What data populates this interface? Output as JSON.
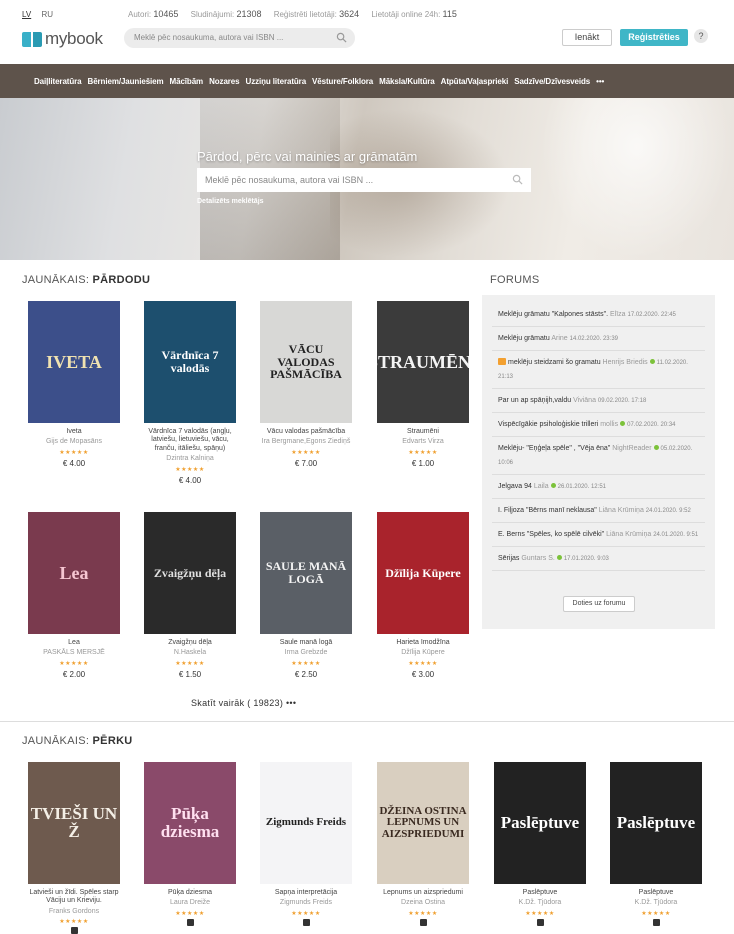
{
  "header": {
    "lang": [
      "LV",
      "RU"
    ],
    "stats": [
      {
        "label": "Autori:",
        "value": "10465"
      },
      {
        "label": "Sludinājumi:",
        "value": "21308"
      },
      {
        "label": "Reģistrēti lietotāji:",
        "value": "3624"
      },
      {
        "label": "Lietotāji online 24h:",
        "value": "115"
      }
    ],
    "logo": "mybook",
    "search_placeholder": "Meklē pēc nosaukuma, autora vai ISBN ...",
    "login": "Ienākt",
    "register": "Reģistrēties",
    "help": "?"
  },
  "nav": [
    "Daiļliteratūra",
    "Bērniem/Jauniešiem",
    "Mācībām",
    "Nozares",
    "Uzziņu literatūra",
    "Vēsture/Folklora",
    "Māksla/Kultūra",
    "Atpūta/Vaļasprieki",
    "Sadzīve/Dzīvesveids",
    "•••"
  ],
  "hero": {
    "title": "Pārdod, pērc vai mainies ar grāmatām",
    "search_placeholder": "Meklē pēc nosaukuma, autora vai ISBN ...",
    "advanced": "Detalizēts meklētājs"
  },
  "selling": {
    "title_prefix": "JAUNĀKAIS:",
    "title_bold": "PĀRDODU",
    "books": [
      {
        "title": "Iveta",
        "author": "Gijs de Mopasāns",
        "price": "€ 4.00",
        "cover_text": "IVETA",
        "bg": "#3c4f8a",
        "fg": "#f0e2b0"
      },
      {
        "title": "Vārdnīca 7 valodās (angļu, latviešu, lietuviešu, vācu, franču, itāliešu, spāņu)",
        "author": "Dzintra Kalniņa",
        "price": "€ 4.00",
        "cover_text": "Vārdnīca 7 valodās",
        "bg": "#1d4f6e",
        "fg": "#ffffff"
      },
      {
        "title": "Vācu valodas pašmācība",
        "author": "Ira Bergmane,Egons Ziediņš",
        "price": "€ 7.00",
        "cover_text": "VĀCU VALODAS PAŠMĀCĪBA",
        "bg": "#d8d8d6",
        "fg": "#222222"
      },
      {
        "title": "Straumēni",
        "author": "Edvarts Virza",
        "price": "€ 1.00",
        "cover_text": "STRAUMĒNI",
        "bg": "#3b3b3b",
        "fg": "#f4f4f4"
      },
      {
        "title": "Lea",
        "author": "PASKĀLS MERSJĒ",
        "price": "€ 2.00",
        "cover_text": "Lea",
        "bg": "#7a3a4e",
        "fg": "#f6c6d2"
      },
      {
        "title": "Zvaigžņu dēļa",
        "author": "N.Haskela",
        "price": "€ 1.50",
        "cover_text": "Zvaigžņu dēļa",
        "bg": "#2a2a2a",
        "fg": "#e0e0e0"
      },
      {
        "title": "Saule manā logā",
        "author": "Irma Grebzde",
        "price": "€ 2.50",
        "cover_text": "SAULE MANĀ LOGĀ",
        "bg": "#5a5f66",
        "fg": "#f4f4f4"
      },
      {
        "title": "Harieta Imodžīna",
        "author": "Džīlija Kūpere",
        "price": "€ 3.00",
        "cover_text": "Džīlija Kūpere",
        "bg": "#a9232c",
        "fg": "#ffffff"
      }
    ],
    "see_more": "Skatīt vairāk ( 19823) •••"
  },
  "forum": {
    "title": "FORUMS",
    "items": [
      {
        "text": "Meklēju grāmatu \"Kalpones stāsts\".",
        "user": "Elīza",
        "date": "17.02.2020. 22:45",
        "online": false,
        "img": false
      },
      {
        "text": "Meklēju grāmatu",
        "user": "Arine",
        "date": "14.02.2020. 23:39",
        "online": false,
        "img": false
      },
      {
        "text": "meklēju steidzami šo gramatu",
        "user": "Henrijs Briedis",
        "date": "11.02.2020. 21:13",
        "online": true,
        "img": true
      },
      {
        "text": "Par un ap spāņijh,valdu",
        "user": "Viviāna",
        "date": "09.02.2020. 17:18",
        "online": false,
        "img": false
      },
      {
        "text": "Vispēcīgākie psiholoģiskie trilleri",
        "user": "mollis",
        "date": "07.02.2020. 20:34",
        "online": true,
        "img": false
      },
      {
        "text": "Meklēju- \"Eņģeļa spēle\" , \"Vēja ēna\"",
        "user": "NightReader",
        "date": "05.02.2020. 10:06",
        "online": true,
        "img": false
      },
      {
        "text": "Jelgava 94",
        "user": "Laila",
        "date": "26.01.2020. 12:51",
        "online": true,
        "img": false
      },
      {
        "text": "I. Fiļjoza \"Bērns manī neklausa\"",
        "user": "Liāna Krūmiņa",
        "date": "24.01.2020. 9:52",
        "online": false,
        "img": false
      },
      {
        "text": "E. Berns \"Spēles, ko spēlē cilvēki\"",
        "user": "Liāna Krūmiņa",
        "date": "24.01.2020. 9:51",
        "online": false,
        "img": false
      },
      {
        "text": "Sērijas",
        "user": "Guntars S.",
        "date": "17.01.2020. 9:03",
        "online": true,
        "img": false
      }
    ],
    "button": "Doties uz forumu"
  },
  "buying": {
    "title_prefix": "JAUNĀKAIS:",
    "title_bold": "PĒRKU",
    "books": [
      {
        "title": "Latvieši un žīdi. Spēles starp Vāciju un Krieviju.",
        "author": "Franks Gordons",
        "cover_text": "TVIEŠI UN Ž",
        "bg": "#6e5a4e",
        "fg": "#f4efe6"
      },
      {
        "title": "Pūķa dziesma",
        "author": "Laura Dreiže",
        "cover_text": "Pūķa dziesma",
        "bg": "#8a4a6a",
        "fg": "#ffe0f0"
      },
      {
        "title": "Sapņa interpretācija",
        "author": "Zigmunds Freids",
        "cover_text": "Zigmunds Freids",
        "bg": "#f4f4f6",
        "fg": "#222222"
      },
      {
        "title": "Lepnums un aizspriedumi",
        "author": "Dzeina Ostina",
        "cover_text": "DŽEINA OSTINA LEPNUMS UN AIZSPRIEDUMI",
        "bg": "#d9cfc0",
        "fg": "#3a2a20"
      },
      {
        "title": "Paslēptuve",
        "author": "K.Dž. Tjūdora",
        "cover_text": "Paslēptuve",
        "bg": "#222222",
        "fg": "#ffffff"
      },
      {
        "title": "Paslēptuve",
        "author": "K.Dž. Tjūdora",
        "cover_text": "Paslēptuve",
        "bg": "#222222",
        "fg": "#ffffff"
      }
    ]
  }
}
